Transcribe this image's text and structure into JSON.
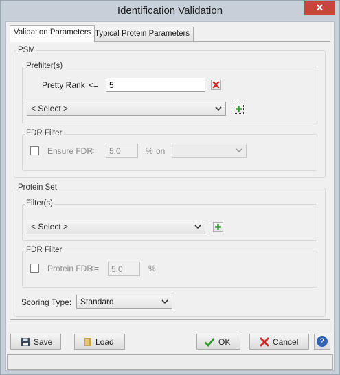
{
  "window": {
    "title": "Identification Validation",
    "close_glyph": "✕"
  },
  "tabs": [
    {
      "label": "Validation Parameters",
      "active": true
    },
    {
      "label": "Typical Protein Parameters",
      "active": false
    }
  ],
  "psm": {
    "title": "PSM",
    "prefilters": {
      "title": "Prefilter(s)",
      "filter_name": "Pretty Rank",
      "operator": "<=",
      "value": "5",
      "select_value": "< Select >"
    },
    "fdr_filter": {
      "title": "FDR Filter",
      "checkbox_label": "Ensure FDR",
      "operator": "<=",
      "value": "5.0",
      "percent_label": "%",
      "on_label": "on",
      "on_select_value": ""
    }
  },
  "protein_set": {
    "title": "Protein Set",
    "filters": {
      "title": "Filter(s)",
      "select_value": "< Select >"
    },
    "fdr_filter": {
      "title": "FDR Filter",
      "checkbox_label": "Protein FDR",
      "operator": "<=",
      "value": "5.0",
      "percent_label": "%"
    }
  },
  "scoring": {
    "label": "Scoring Type:",
    "value": "Standard"
  },
  "buttons": {
    "save": "Save",
    "load": "Load",
    "ok": "OK",
    "cancel": "Cancel",
    "help_glyph": "?"
  },
  "colors": {
    "title_bar": "#c7cfd8",
    "close_button": "#c7453b",
    "remove_icon": "#cc2b2b",
    "add_icon": "#3a9a3a",
    "ok_check": "#2e9a2e",
    "cancel_x": "#cc2b2b",
    "help_circle": "#2f62b5"
  },
  "icons": {
    "close": "close-icon",
    "remove_filter": "remove-filter-icon",
    "add_filter": "add-filter-icon",
    "save": "floppy-disk-icon",
    "load": "folder-icon",
    "ok": "checkmark-icon",
    "cancel": "x-icon",
    "help": "help-icon"
  }
}
